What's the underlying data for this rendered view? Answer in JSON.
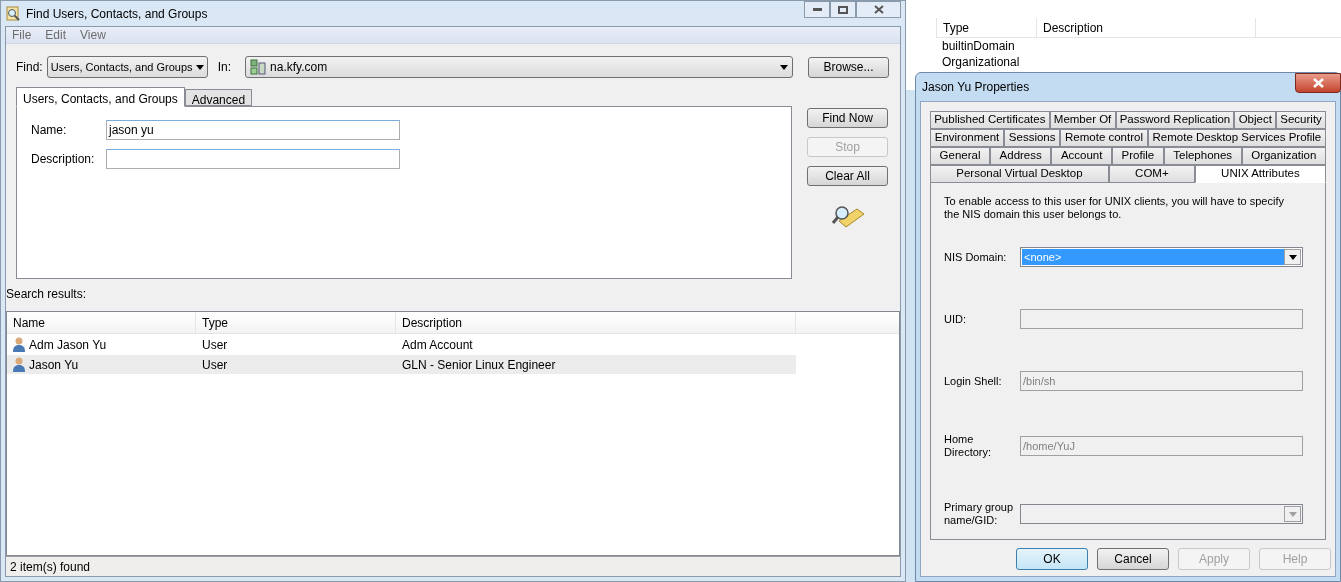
{
  "background_window": {
    "columns": [
      "Type",
      "Description"
    ],
    "rows": [
      "builtinDomain",
      "Organizational"
    ]
  },
  "find_window": {
    "title": "Find Users, Contacts, and Groups",
    "menu": [
      "File",
      "Edit",
      "View"
    ],
    "find_label": "Find:",
    "find_value": "Users, Contacts, and Groups",
    "in_label": "In:",
    "in_value": "na.kfy.com",
    "browse": "Browse...",
    "tabs": [
      {
        "label": "Users, Contacts, and Groups",
        "selected": true
      },
      {
        "label": "Advanced",
        "selected": false
      }
    ],
    "fields": [
      {
        "label": "Name:",
        "value": "jason yu"
      },
      {
        "label": "Description:"
      }
    ],
    "buttons": [
      {
        "label": "Find Now",
        "disabled": false
      },
      {
        "label": "Stop",
        "disabled": true
      },
      {
        "label": "Clear All",
        "disabled": false
      }
    ],
    "results_label": "Search results:",
    "columns": [
      "Name",
      "Type",
      "Description"
    ],
    "rows": [
      {
        "cells": [
          "Adm Jason Yu",
          "User",
          "Adm Account"
        ],
        "selected": false
      },
      {
        "cells": [
          "Jason Yu",
          "User",
          "GLN - Senior Linux Engineer"
        ],
        "selected": true
      }
    ],
    "status": "2 item(s) found"
  },
  "properties": {
    "title": "Jason Yu Properties",
    "tab_rows": [
      [
        {
          "label": "Published Certificates",
          "selected": false
        },
        {
          "label": "Member Of",
          "selected": false
        },
        {
          "label": "Password Replication",
          "selected": false
        },
        {
          "label": "Object",
          "selected": false
        },
        {
          "label": "Security",
          "selected": false
        }
      ],
      [
        {
          "label": "Environment",
          "selected": false
        },
        {
          "label": "Sessions",
          "selected": false
        },
        {
          "label": "Remote control",
          "selected": false
        },
        {
          "label": "Remote Desktop Services Profile",
          "selected": false
        }
      ],
      [
        {
          "label": "General",
          "selected": false
        },
        {
          "label": "Address",
          "selected": false
        },
        {
          "label": "Account",
          "selected": false
        },
        {
          "label": "Profile",
          "selected": false
        },
        {
          "label": "Telephones",
          "selected": false
        },
        {
          "label": "Organization",
          "selected": false
        }
      ],
      [
        {
          "label": "Personal Virtual Desktop",
          "selected": false
        },
        {
          "label": "COM+",
          "selected": false
        },
        {
          "label": "UNIX Attributes",
          "selected": true
        }
      ]
    ],
    "intro": "To enable access to this user for UNIX clients, you will have to specify the NIS domain this user belongs to.",
    "fields": [
      {
        "kind": "dropdown",
        "label": "NIS Domain:",
        "value": "<none>",
        "highlighted": true,
        "disabled": false
      },
      {
        "kind": "text",
        "label": "UID:",
        "disabled": true
      },
      {
        "kind": "text",
        "label": "Login Shell:",
        "value": "/bin/sh",
        "disabled": true
      },
      {
        "kind": "text",
        "label": "Home Directory:",
        "value": "/home/YuJ",
        "disabled": true
      },
      {
        "kind": "dropdown",
        "label": "Primary group name/GID:",
        "highlighted": false,
        "disabled": true
      }
    ],
    "buttons": [
      {
        "label": "OK",
        "default": true,
        "disabled": false
      },
      {
        "label": "Cancel",
        "default": false,
        "disabled": false
      },
      {
        "label": "Apply",
        "default": false,
        "disabled": true
      },
      {
        "label": "Help",
        "default": false,
        "disabled": true
      }
    ]
  }
}
